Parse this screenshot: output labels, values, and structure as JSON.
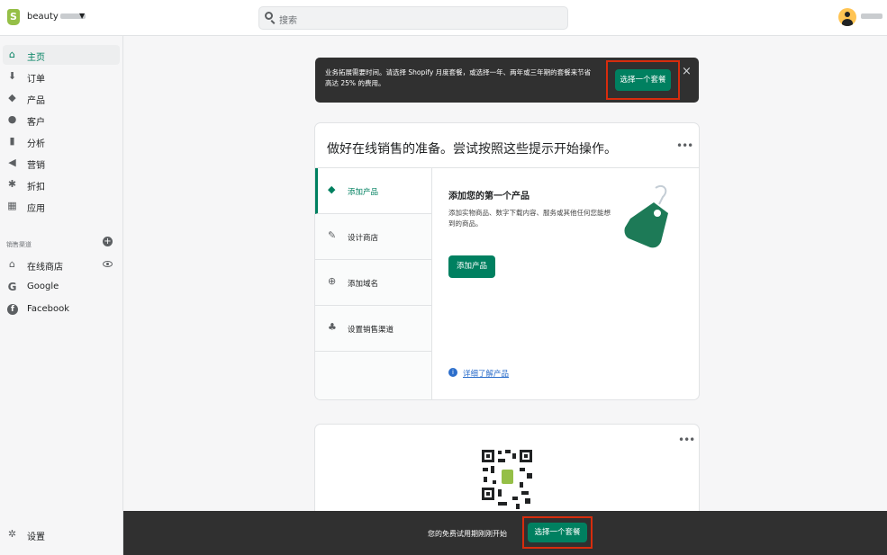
{
  "topbar": {
    "store_name": "beauty",
    "store_caret": "▼",
    "search_placeholder": "搜索"
  },
  "sidebar": {
    "items": [
      {
        "label": "主页",
        "icon": "home-icon",
        "glyph": "⌂"
      },
      {
        "label": "订单",
        "icon": "orders-icon",
        "glyph": "⬇"
      },
      {
        "label": "产品",
        "icon": "tag-icon",
        "glyph": "◆"
      },
      {
        "label": "客户",
        "icon": "person-icon",
        "glyph": "●"
      },
      {
        "label": "分析",
        "icon": "analytics-icon",
        "glyph": "▮"
      },
      {
        "label": "营销",
        "icon": "megaphone-icon",
        "glyph": "◀"
      },
      {
        "label": "折扣",
        "icon": "discount-icon",
        "glyph": "✱"
      },
      {
        "label": "应用",
        "icon": "apps-icon",
        "glyph": "▦"
      }
    ],
    "sales_channels_title": "销售渠道",
    "channels": [
      {
        "label": "在线商店",
        "icon": "store-icon",
        "glyph": "⌂"
      },
      {
        "label": "Google",
        "icon": "google-icon",
        "glyph": "G"
      },
      {
        "label": "Facebook",
        "icon": "facebook-icon",
        "glyph": "f"
      }
    ],
    "settings_label": "设置",
    "settings_glyph": "✲"
  },
  "banner": {
    "text": "业务拓展需要时间。请选择 Shopify 月度套餐，或选择一年、两年或三年期的套餐来节省高达 25% 的费用。",
    "button": "选择一个套餐",
    "close": "×"
  },
  "setup_card": {
    "title": "做好在线销售的准备。尝试按照这些提示开始操作。",
    "more": "•••",
    "tabs": [
      {
        "label": "添加产品",
        "icon": "tag-icon",
        "glyph": "◆"
      },
      {
        "label": "设计商店",
        "icon": "brush-icon",
        "glyph": "✎"
      },
      {
        "label": "添加域名",
        "icon": "globe-icon",
        "glyph": "⊕"
      },
      {
        "label": "设置销售渠道",
        "icon": "channels-icon",
        "glyph": "♣"
      }
    ],
    "panel_title": "添加您的第一个产品",
    "panel_desc": "添加实物商品、数字下载内容、服务或其他任何您能想到的商品。",
    "panel_button": "添加产品",
    "learn_more": "详细了解产品",
    "info_glyph": "i"
  },
  "qr_card": {
    "more": "•••"
  },
  "bottom_bar": {
    "text": "您的免费试用期刚刚开始",
    "button": "选择一个套餐"
  },
  "colors": {
    "accent": "#008060",
    "dark_bar": "#303030",
    "highlight": "#d72c0d",
    "logo": "#95bf47"
  }
}
